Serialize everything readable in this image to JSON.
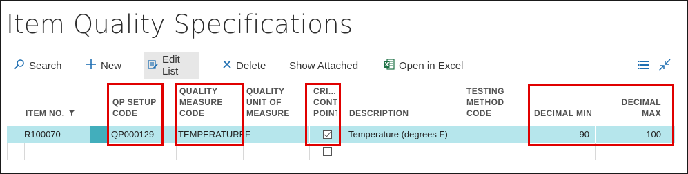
{
  "page": {
    "title": "Item Quality Specifications"
  },
  "toolbar": {
    "search": "Search",
    "new": "New",
    "edit_list": "Edit List",
    "delete": "Delete",
    "show_attached": "Show Attached",
    "open_excel": "Open in Excel"
  },
  "columns": {
    "item_no": "ITEM NO.",
    "qp_setup_l1": "QP SETUP",
    "qp_setup_l2": "CODE",
    "qmc_l1": "QUALITY",
    "qmc_l2": "MEASURE",
    "qmc_l3": "CODE",
    "qum_l1": "QUALITY",
    "qum_l2": "UNIT OF",
    "qum_l3": "MEASURE",
    "crit_l1": "CRI...",
    "crit_l2": "CONT",
    "crit_l3": "POINT",
    "description": "DESCRIPTION",
    "tmc_l1": "TESTING",
    "tmc_l2": "METHOD",
    "tmc_l3": "CODE",
    "dec_min": "DECIMAL MIN",
    "dec_max_l1": "DECIMAL",
    "dec_max_l2": "MAX"
  },
  "rows": [
    {
      "item_no": "R100070",
      "qp_setup_code": "QP000129",
      "quality_measure_code": "TEMPERATURE",
      "quality_unit": "F",
      "critical_control_point": true,
      "description": "Temperature (degrees F)",
      "testing_method_code": "",
      "decimal_min": "90",
      "decimal_max": "100"
    },
    {
      "item_no": "",
      "qp_setup_code": "",
      "quality_measure_code": "",
      "quality_unit": "",
      "critical_control_point": false,
      "description": "",
      "testing_method_code": "",
      "decimal_min": "",
      "decimal_max": ""
    }
  ],
  "colors": {
    "selected_row": "#b6e6ec",
    "row_indicator": "#42aebc",
    "highlight_box": "#e00000",
    "excel_green": "#1e7145",
    "accent_blue": "#1f6fb2"
  },
  "icons": [
    "search-icon",
    "plus-icon",
    "edit-list-icon",
    "delete-icon",
    "excel-icon",
    "list-view-icon",
    "collapse-icon",
    "filter-icon"
  ]
}
